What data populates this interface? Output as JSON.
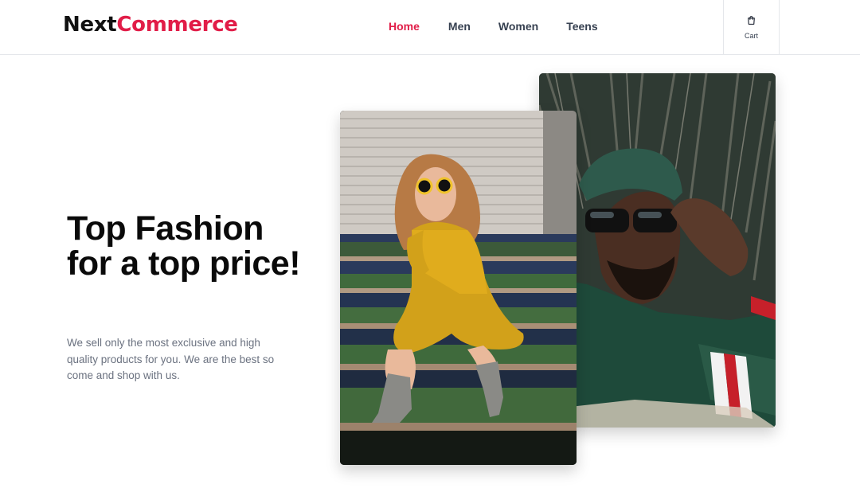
{
  "header": {
    "logo_part1": "Next",
    "logo_part2": "Commerce",
    "nav": [
      {
        "label": "Home",
        "active": true
      },
      {
        "label": "Men",
        "active": false
      },
      {
        "label": "Women",
        "active": false
      },
      {
        "label": "Teens",
        "active": false
      }
    ],
    "cart_label": "Cart",
    "cart_icon": "shopping-bag-icon"
  },
  "hero": {
    "headline": "Top Fashion for a top price!",
    "subtext": "We sell only the most exclusive and high quality products for you. We are the best so come and shop with us."
  },
  "colors": {
    "accent": "#e11d48",
    "text_dark": "#0a0a0a",
    "text_muted": "#6b7280",
    "border": "#e5e7eb"
  }
}
